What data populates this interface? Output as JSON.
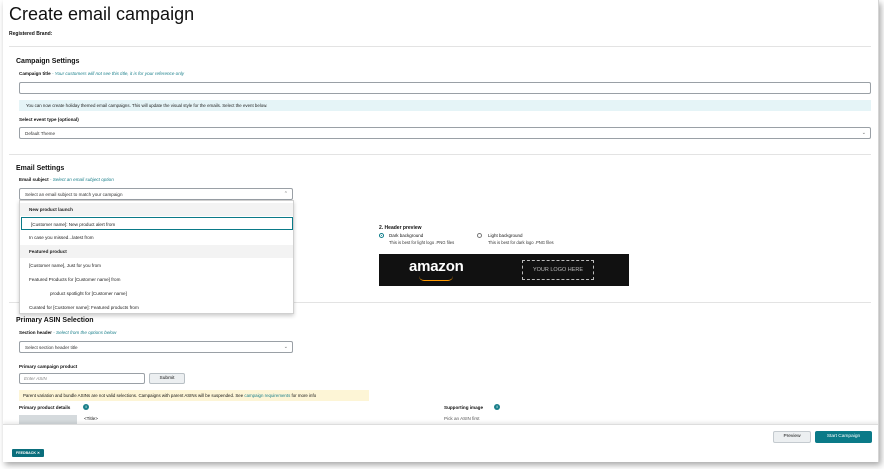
{
  "page": {
    "title": "Create email campaign",
    "registered_brand_label": "Registered Brand:"
  },
  "campaign_settings": {
    "title": "Campaign Settings",
    "campaign_title_label": "Campaign title",
    "campaign_title_hint": "- Your customers will not see this title, it is for your reference only",
    "campaign_title_value": "",
    "info_message": "You can now create holiday themed email campaigns. This will update the visual style for the emails. Select the event below.",
    "event_type_label": "Select event type (optional)",
    "event_type_value": "Default Theme"
  },
  "email_settings": {
    "title": "Email Settings",
    "subject_label": "Email subject",
    "subject_hint": "- Select an email subject option",
    "subject_placeholder": "Select an email subject to match your campaign",
    "dropdown": {
      "groups": [
        {
          "label": "New product launch",
          "options": [
            "[Customer name]: New product alert from",
            "In case you missed...latest from"
          ]
        },
        {
          "label": "Featured product",
          "options": [
            "[Customer name], Just for you from",
            "Featured Products for [Customer name] from",
            "product spotlight for [Customer name]",
            "Curated for [Customer name]: Featured products from"
          ]
        }
      ]
    },
    "header_preview": {
      "label": "2. Header preview",
      "dark_label": "Dark background",
      "dark_sub": "This is best for light logo .PNG files",
      "light_label": "Light background",
      "light_sub": "This is best for dark logo .PNG files",
      "brand_wordmark": "amazon",
      "logo_placeholder": "YOUR LOGO HERE"
    }
  },
  "primary_asin": {
    "title": "Primary ASIN Selection",
    "section_header_label": "Section header",
    "section_header_hint": "- Select from the options below",
    "section_header_placeholder": "Select section header title",
    "product_label": "Primary campaign product",
    "asin_placeholder": "Enter ASIN",
    "submit_label": "Submit",
    "warning_text": "Parent variation and bundle ASINs are not valid selections. Campaigns with parent ASINs will be suspended. See",
    "warning_link": "campaign requirements",
    "warning_tail": "for more info",
    "product_details_label": "Primary product details",
    "title_placeholder": "<Title>",
    "supporting_image_label": "Supporting image",
    "supporting_image_hint": "Pick an ASIN first"
  },
  "footer": {
    "preview_label": "Preview",
    "start_label": "Start Campaign",
    "feedback_label": "FEEDBACK ✕"
  }
}
